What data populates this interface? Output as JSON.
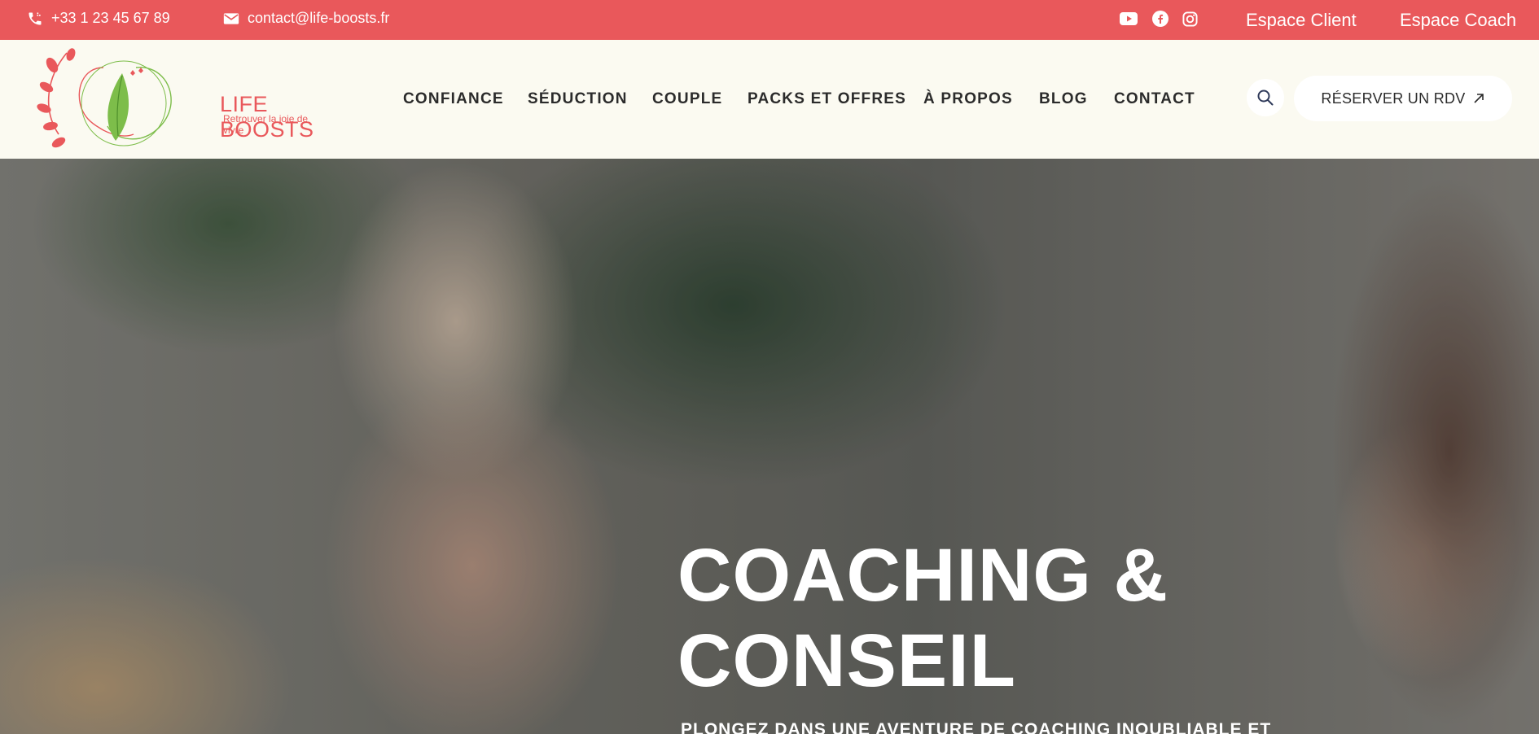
{
  "topbar": {
    "phone": "+33 1 23 45 67 89",
    "email": "contact@life-boosts.fr",
    "social": [
      "youtube-icon",
      "facebook-icon",
      "instagram-icon"
    ],
    "espace_client": "Espace Client",
    "espace_coach": "Espace Coach"
  },
  "logo": {
    "title": "LIFE BOOSTS",
    "subtitle": "Retrouver la joie de vivre"
  },
  "nav": {
    "items": [
      "CONFIANCE",
      "SÉDUCTION",
      "COUPLE",
      "PACKS ET OFFRES",
      "À PROPOS",
      "BLOG",
      "CONTACT"
    ],
    "cta": "RÉSERVER UN RDV"
  },
  "hero": {
    "title_line1": "COACHING &",
    "title_line2": "CONSEIL",
    "subtitle": "PLONGEZ DANS UNE AVENTURE DE COACHING INOUBLIABLE ET"
  },
  "colors": {
    "brand": "#e9585b",
    "header_bg": "#fbfaf1",
    "logo_green": "#7dbd4a"
  }
}
